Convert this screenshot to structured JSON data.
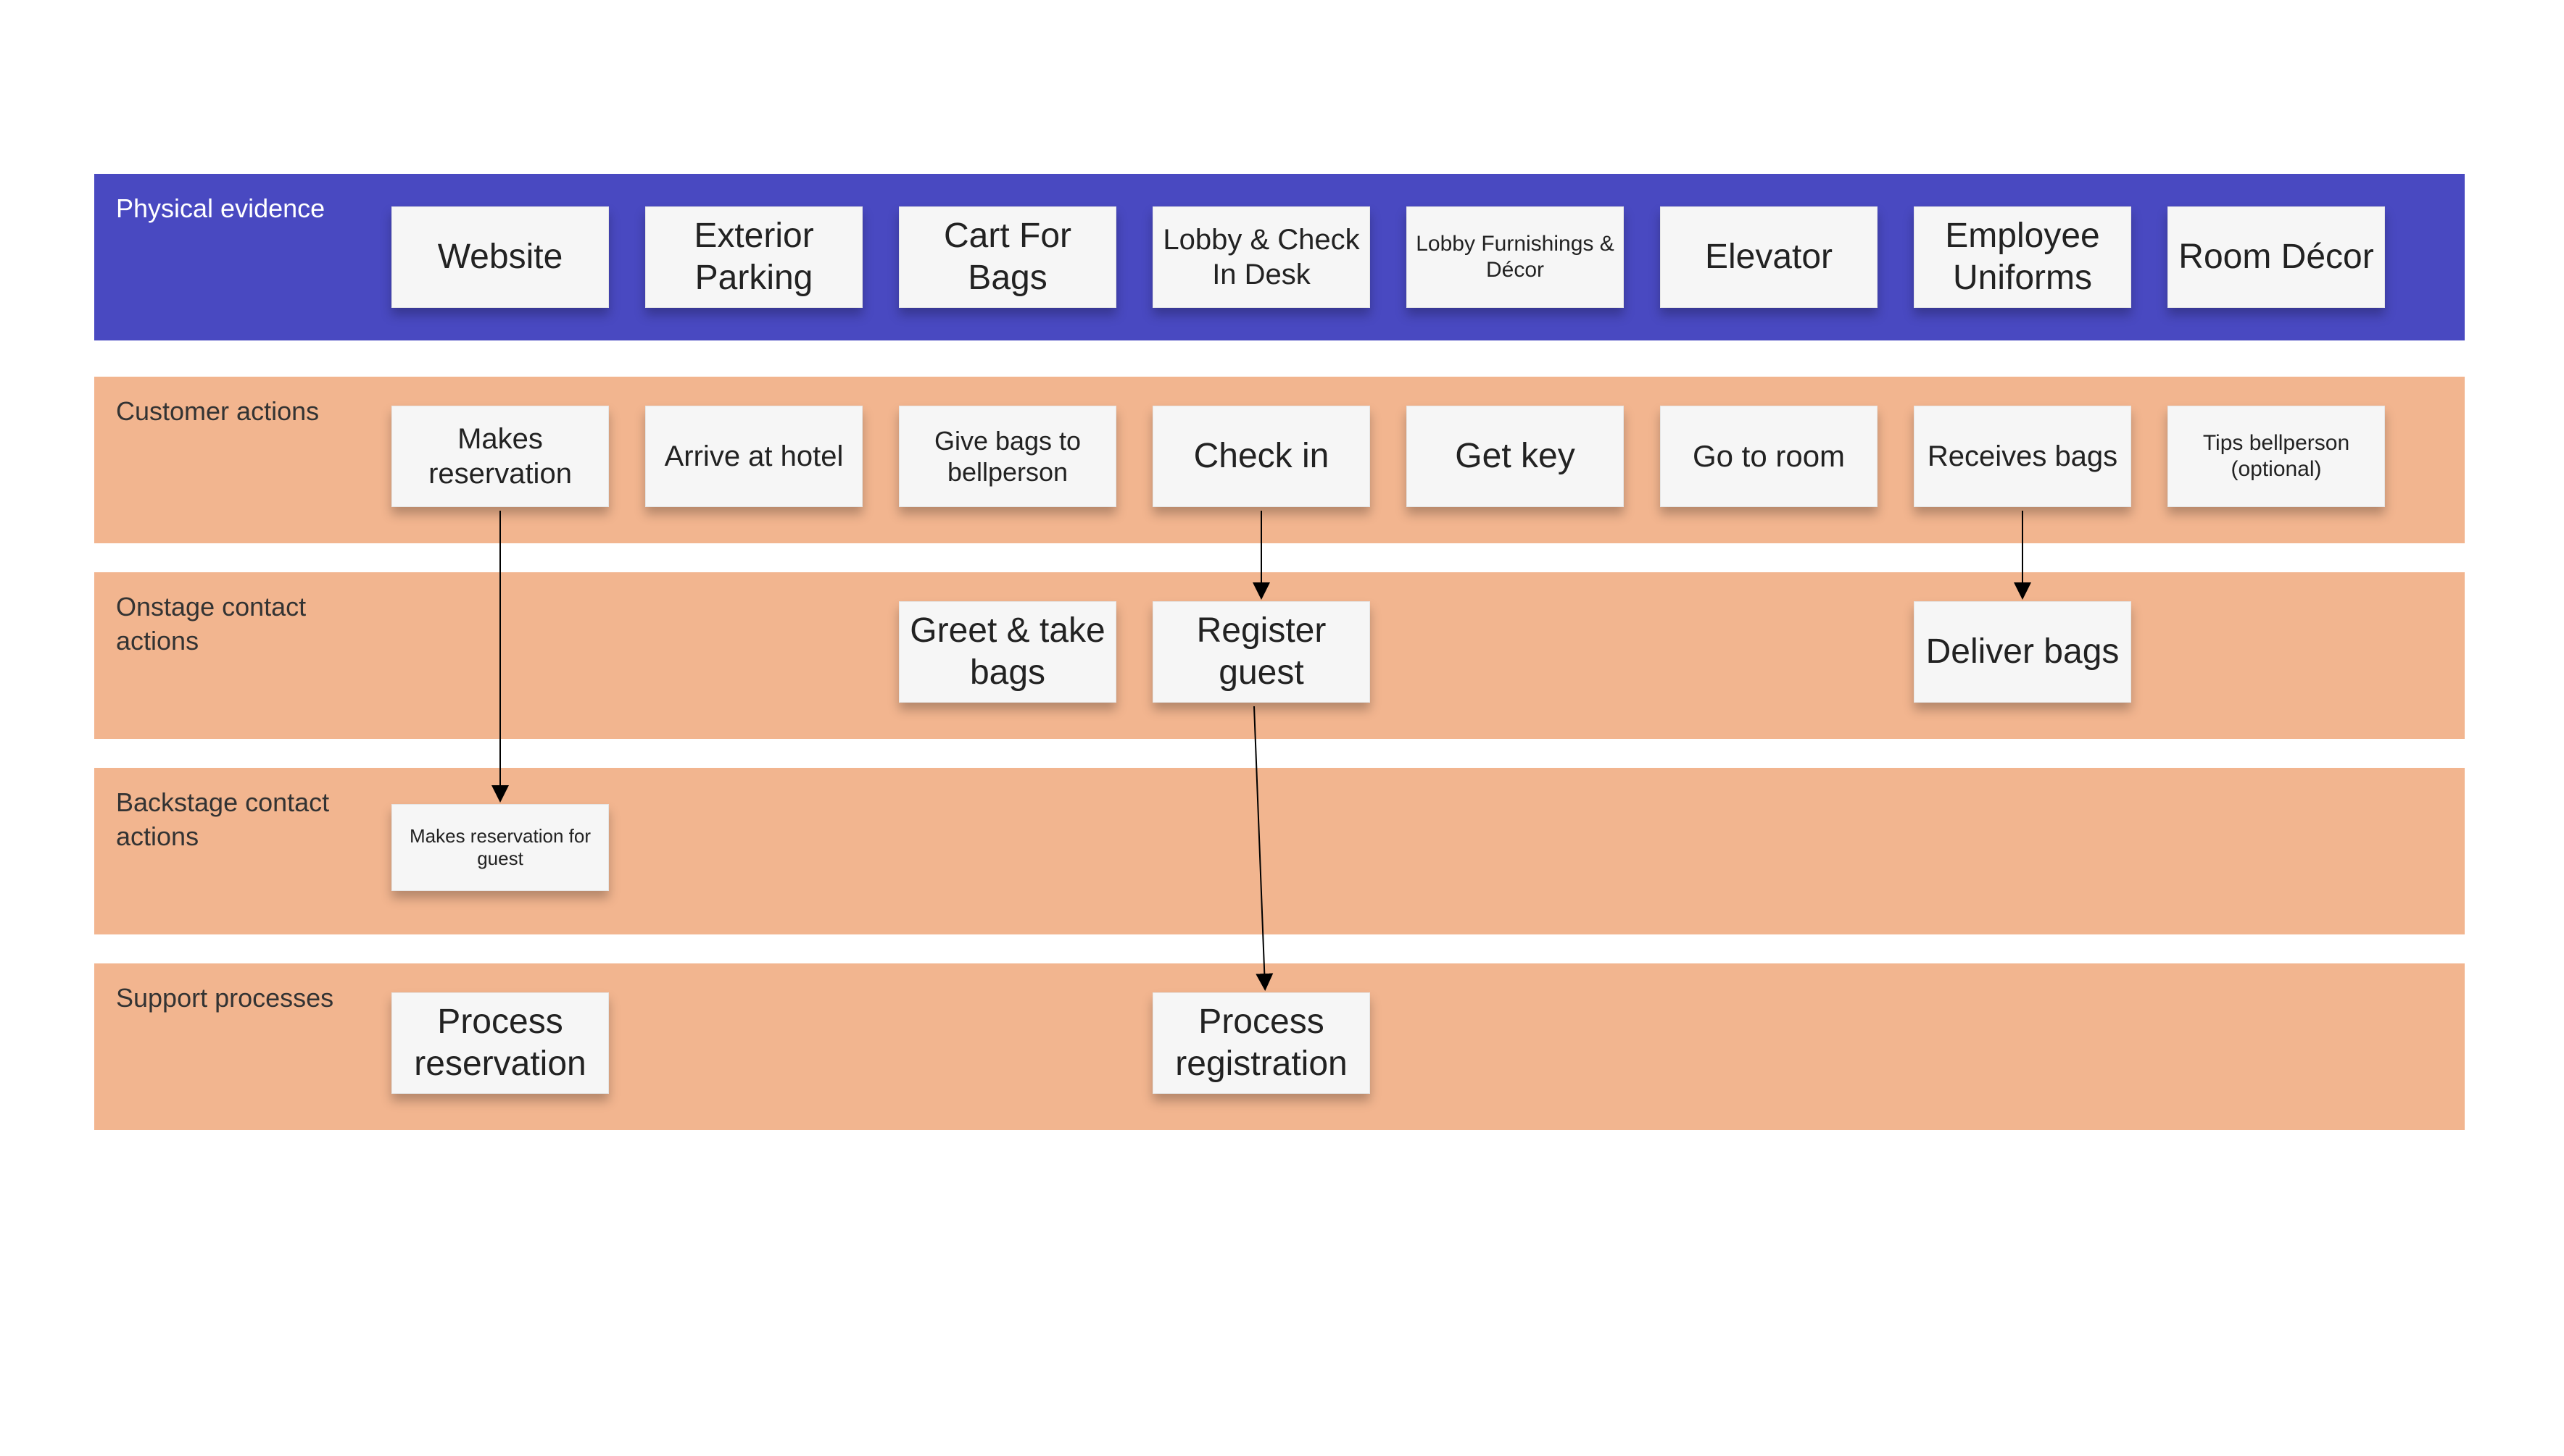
{
  "lanes": {
    "physical_evidence": {
      "label": "Physical evidence",
      "cards": [
        "Website",
        "Exterior Parking",
        "Cart For Bags",
        "Lobby & Check In Desk",
        "Lobby Furnishings & Décor",
        "Elevator",
        "Employee Uniforms",
        "Room Décor"
      ]
    },
    "customer_actions": {
      "label": "Customer actions",
      "cards": [
        "Makes reservation",
        "Arrive at hotel",
        "Give bags to bellperson",
        "Check in",
        "Get key",
        "Go to room",
        "Receives bags",
        "Tips bellperson (optional)"
      ]
    },
    "onstage": {
      "label": "Onstage contact actions",
      "cards": [
        "Greet & take bags",
        "Register guest",
        "Deliver bags"
      ]
    },
    "backstage": {
      "label": "Backstage contact actions",
      "cards": [
        "Makes reservation for guest"
      ]
    },
    "support": {
      "label": "Support processes",
      "cards": [
        "Process reservation",
        "Process registration"
      ]
    }
  },
  "arrows": [
    {
      "from": "customer_actions.0",
      "to": "backstage.0"
    },
    {
      "from": "customer_actions.3",
      "to": "onstage.1"
    },
    {
      "from": "onstage.1",
      "to": "support.1"
    },
    {
      "from": "customer_actions.6",
      "to": "onstage.2"
    }
  ]
}
